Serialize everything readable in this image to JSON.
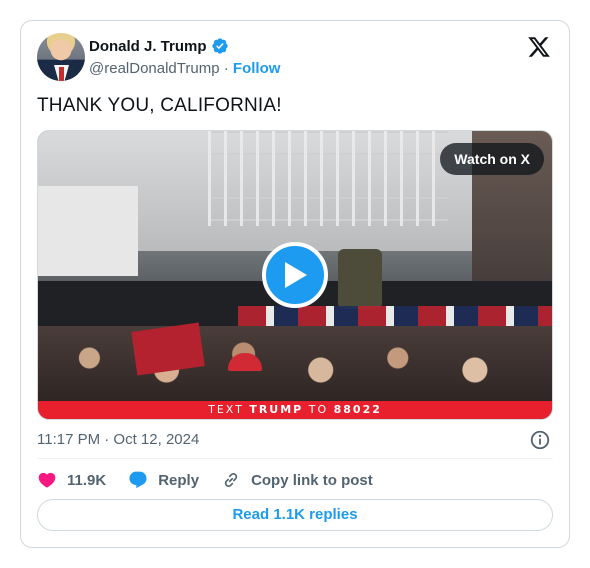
{
  "author": {
    "display_name": "Donald J. Trump",
    "handle": "@realDonaldTrump",
    "separator": "·",
    "follow_label": "Follow",
    "verified_icon": "verified-badge-icon"
  },
  "tweet": {
    "text": "THANK YOU, CALIFORNIA!",
    "timestamp": "11:17 PM · Oct 12, 2024"
  },
  "media": {
    "watch_label": "Watch on X",
    "banner_prefix": "TEXT ",
    "banner_name": "TRUMP",
    "banner_mid": " TO ",
    "banner_number": "88022",
    "sign_text": "TEXT TRUMP 88022"
  },
  "actions": {
    "likes": "11.9K",
    "reply_label": "Reply",
    "copy_link_label": "Copy link to post"
  },
  "replies_button": "Read 1.1K replies",
  "colors": {
    "accent": "#1d9bf0",
    "like": "#f91880",
    "text": "#0f1419",
    "muted": "#536471",
    "border": "#cfd9de",
    "banner_red": "#e8202d"
  }
}
